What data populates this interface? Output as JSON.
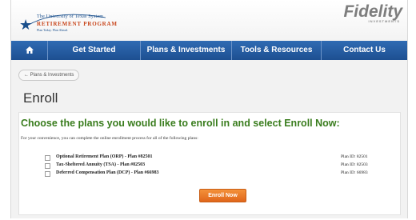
{
  "header": {
    "logo": {
      "line1": "The University of Texas System",
      "line2": "RETIREMENT PROGRAM",
      "line3": "Plan Today. Plan Ahead."
    },
    "fidelity_logo": "Fidelity",
    "fidelity_sub": "INVESTMENTS"
  },
  "nav": {
    "home_icon": "home-icon",
    "items": [
      "Get Started",
      "Plans & Investments",
      "Tools & Resources",
      "Contact Us"
    ]
  },
  "breadcrumb": "← Plans & Investments",
  "page_title": "Enroll",
  "main": {
    "heading": "Choose the plans you would like to enroll in and select Enroll Now:",
    "intro": "For your convenience, you can complete the online enrollment process for all of the following plans:",
    "plans": [
      {
        "name": "Optional Retirement Plan (ORP) - Plan #82501",
        "plan_id": "Plan ID: 82501",
        "checked": false
      },
      {
        "name": "Tax-Sheltered Annuity (TSA) - Plan #82503",
        "plan_id": "Plan ID: 82503",
        "checked": false
      },
      {
        "name": "Deferred Compensation Plan (DCP) - Plan #66983",
        "plan_id": "Plan ID: 66983",
        "checked": false
      }
    ],
    "enroll_button": "Enroll Now"
  },
  "colors": {
    "nav_blue": "#1d4f91",
    "heading_green": "#3a7d1e",
    "button_orange": "#e0661a"
  }
}
